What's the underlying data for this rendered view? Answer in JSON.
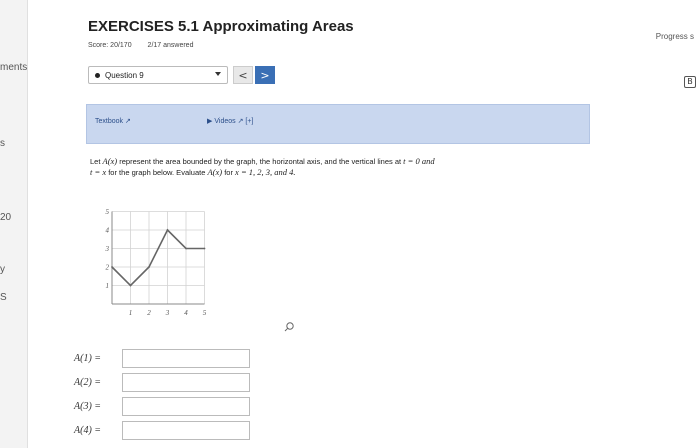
{
  "sidebar": {
    "items": [
      {
        "label": "ments"
      },
      {
        "label": "s"
      },
      {
        "label": "20"
      },
      {
        "label": "y"
      },
      {
        "label": "S"
      }
    ]
  },
  "header": {
    "title": "EXERCISES 5.1 Approximating Areas",
    "score": "Score: 20/170",
    "answered": "2/17 answered",
    "progress": "Progress s"
  },
  "question_nav": {
    "selected": "Question 9",
    "prev": "<",
    "next": ">"
  },
  "right_icon": "B",
  "resources": {
    "textbook": "Textbook",
    "videos": "Videos",
    "videos_extra": "[+]"
  },
  "prompt": {
    "p1": "Let ",
    "Ax": "A(x)",
    "p2": " represent the area bounded by the graph, the horizontal axis, and the vertical lines at ",
    "t": "t",
    "eq0": " = 0 and",
    "t2": "t",
    "eqx": " = x",
    "p3": " for the graph below. Evaluate ",
    "Ax2": "A(x)",
    "p4": " for ",
    "x": "x",
    "p5": " = 1, 2, 3, and 4."
  },
  "chart_data": {
    "type": "line",
    "x": [
      0,
      1,
      2,
      3,
      4,
      5
    ],
    "y": [
      2,
      1,
      2,
      4,
      3,
      3
    ],
    "xlim": [
      0,
      5
    ],
    "ylim": [
      0,
      5
    ],
    "xticks": [
      "1",
      "2",
      "3",
      "4",
      "5"
    ],
    "yticks": [
      "1",
      "2",
      "3",
      "4",
      "5"
    ],
    "grid": true,
    "color": "#666666"
  },
  "answers": [
    {
      "label": "A(1) =",
      "value": ""
    },
    {
      "label": "A(2) =",
      "value": ""
    },
    {
      "label": "A(3) =",
      "value": ""
    },
    {
      "label": "A(4) =",
      "value": ""
    }
  ]
}
